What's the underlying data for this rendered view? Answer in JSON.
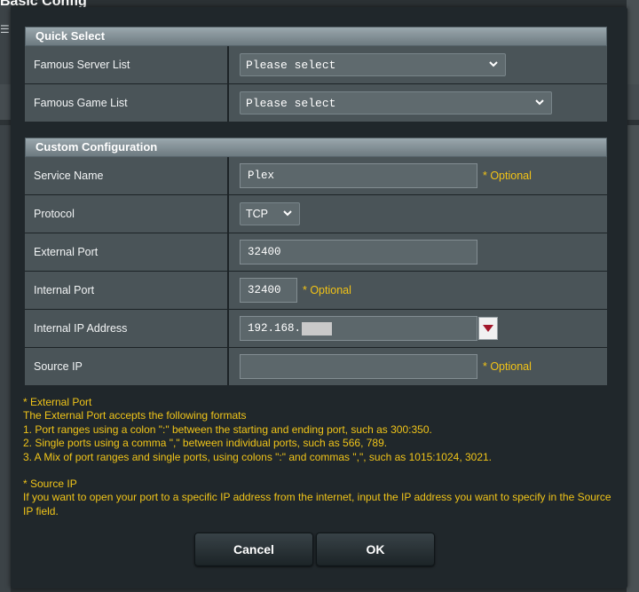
{
  "background": {
    "title": "Basic Config",
    "menu_glyph": "☰"
  },
  "quick_select": {
    "header": "Quick Select",
    "famous_server_label": "Famous Server List",
    "famous_server_value": "Please select",
    "famous_game_label": "Famous Game List",
    "famous_game_value": "Please select"
  },
  "custom": {
    "header": "Custom Configuration",
    "service_name_label": "Service Name",
    "service_name_value": "Plex",
    "service_name_hint": "* Optional",
    "protocol_label": "Protocol",
    "protocol_value": "TCP",
    "external_port_label": "External Port",
    "external_port_value": "32400",
    "internal_port_label": "Internal Port",
    "internal_port_value": "32400",
    "internal_port_hint": "* Optional",
    "internal_ip_label": "Internal IP Address",
    "internal_ip_value": "192.168.",
    "source_ip_label": "Source IP",
    "source_ip_value": "",
    "source_ip_hint": "* Optional"
  },
  "notes": {
    "ext_title": "* External Port",
    "ext_intro": "The External Port accepts the following formats",
    "ext_1": "1. Port ranges using a colon \":\" between the starting and ending port, such as 300:350.",
    "ext_2": "2. Single ports using a comma \",\" between individual ports, such as 566, 789.",
    "ext_3": "3. A Mix of port ranges and single ports, using colons \":\" and commas \",\", such as 1015:1024, 3021.",
    "src_title": "* Source IP",
    "src_text": "If you want to open your port to a specific IP address from the internet, input the IP address you want to specify in the Source IP field."
  },
  "buttons": {
    "cancel": "Cancel",
    "ok": "OK"
  },
  "colors": {
    "accent_hint": "#f2c316",
    "panel": "#4a5458",
    "modal": "#20272b"
  }
}
